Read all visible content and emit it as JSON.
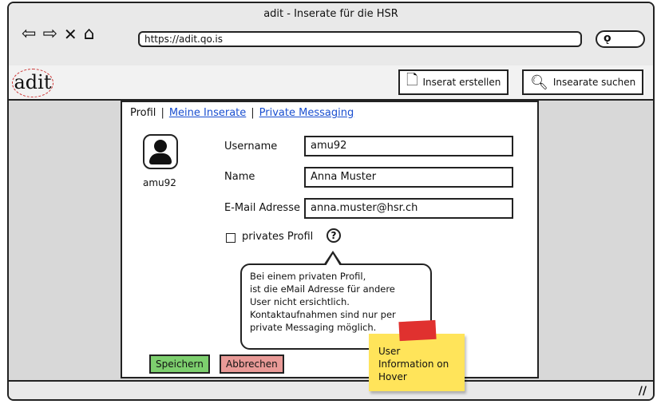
{
  "window": {
    "title": "adit - Inserate für die HSR"
  },
  "browser": {
    "nav_icons": [
      "arrow-left-icon",
      "arrow-right-icon",
      "close-icon",
      "home-icon"
    ],
    "url": "https://adit.qo.is",
    "search_icon": "search-icon"
  },
  "app": {
    "logo": "adit",
    "create_label": "Inserat erstellen",
    "search_label": "Insearate suchen"
  },
  "tabs": {
    "active": "Profil",
    "my_ads": "Meine Inserate",
    "messaging": "Private Messaging"
  },
  "profile": {
    "avatar_name": "amu92",
    "username_label": "Username",
    "username_value": "amu92",
    "name_label": "Name",
    "name_value": "Anna Muster",
    "email_label": "E-Mail Adresse",
    "email_value": "anna.muster@hsr.ch",
    "private_label": "privates Profil",
    "help_glyph": "?"
  },
  "tooltip": {
    "line1": "Bei einem privaten Profil,",
    "line2": "ist die eMail Adresse für andere",
    "line3": "User nicht ersichtlich.",
    "line4": "Kontaktaufnahmen sind nur per",
    "line5": "private Messaging möglich."
  },
  "actions": {
    "save": "Speichern",
    "cancel": "Abbrechen"
  },
  "note": {
    "line1": "User",
    "line2": "Information on",
    "line3": "Hover"
  },
  "colors": {
    "save": "#7dcf6e",
    "cancel": "#e99a97",
    "note": "#ffe45a",
    "tape": "#e0312f",
    "link": "#1a4fd0"
  }
}
